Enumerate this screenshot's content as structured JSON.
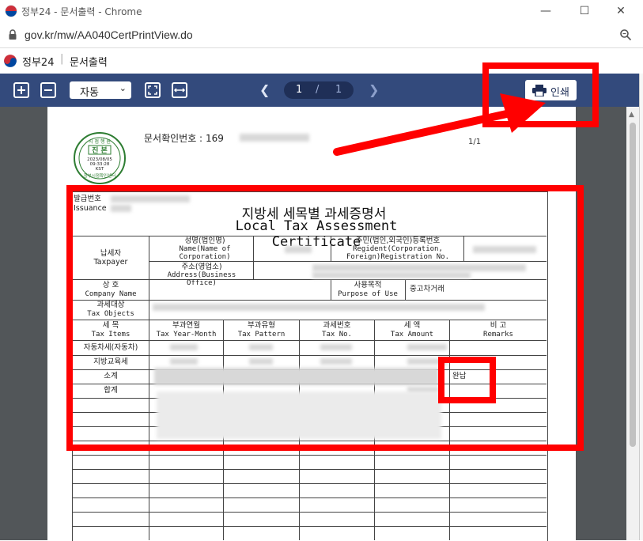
{
  "browser": {
    "title": "정부24 - 문서출력 - Chrome",
    "url": "gov.kr/mw/AA040CertPrintView.do",
    "controls": {
      "minimize": "—",
      "maximize": "☐",
      "close": "✕"
    }
  },
  "site": {
    "name": "정부24",
    "separator": "|",
    "page": "문서출력"
  },
  "toolbar": {
    "zoom_value": "자동",
    "page_current": "1",
    "page_separator": "/",
    "page_total": "1",
    "print_label": "인쇄",
    "icons": [
      "zoom-in-icon",
      "zoom-out-icon",
      "fit-page-icon",
      "fit-width-icon",
      "prev-page-icon",
      "next-page-icon",
      "printer-icon"
    ]
  },
  "document": {
    "doc_check_label": "문서확인번호 :",
    "doc_check_prefix": "169",
    "page_indicator": "1/1",
    "stamp": {
      "top_text": "시 점 행 원",
      "center": "진 본",
      "date": "2023/08/05",
      "time": "09:33:28",
      "tz": "KST",
      "bottom_text": "정부시점확인센터"
    },
    "issue_label_ko": "발급번호",
    "issue_label_en": "Issuance",
    "title_ko": "지방세 세목별 과세증명서",
    "title_en": "Local Tax Assessment Certificate",
    "taxpayer_ko": "납세자",
    "taxpayer_en": "Taxpayer",
    "name_ko": "성명(법인명)",
    "name_en1": "Name(Name of",
    "name_en2": "Corporation)",
    "regno_ko": "주민(법인,외국인)등록번호",
    "regno_en1": "Regident(Corporation,",
    "regno_en2": "Foreign)Registration No.",
    "address_ko": "주소(영업소)",
    "address_en": "Address(Business Office)",
    "company_ko": "상      호",
    "company_en": "Company Name",
    "purpose_ko": "사용목적",
    "purpose_en": "Purpose of Use",
    "purpose_value": "중고차거래",
    "taxobj_ko": "과세대상",
    "taxobj_en": "Tax Objects",
    "col_headers": [
      {
        "ko": "세    목",
        "en": "Tax Items"
      },
      {
        "ko": "부과연월",
        "en": "Tax Year-Month"
      },
      {
        "ko": "부과유형",
        "en": "Tax Pattern"
      },
      {
        "ko": "과세번호",
        "en": "Tax No."
      },
      {
        "ko": "세    액",
        "en": "Tax Amount"
      },
      {
        "ko": "비    고",
        "en": "Remarks"
      }
    ],
    "rows": [
      {
        "item": "자동차세(자동차)",
        "remark": ""
      },
      {
        "item": "지방교육세",
        "remark": ""
      },
      {
        "item": "소계",
        "remark": "완납"
      },
      {
        "item": "합계",
        "remark": ""
      }
    ]
  },
  "annotations": {
    "color": "#ff0000"
  }
}
